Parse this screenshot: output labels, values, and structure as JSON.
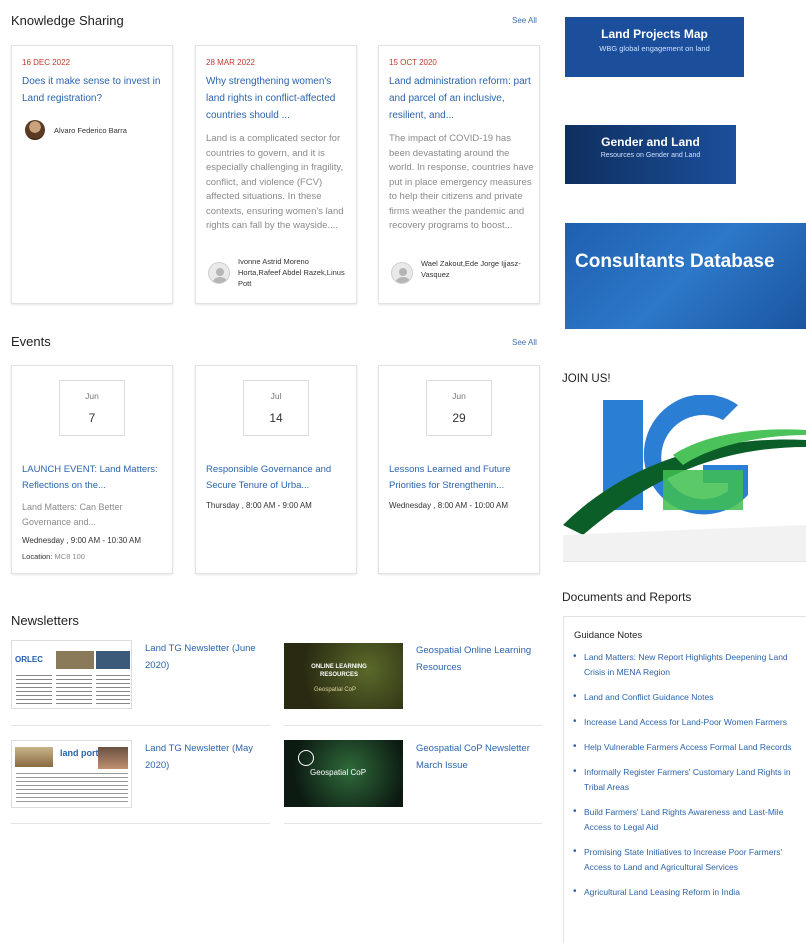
{
  "knowledge": {
    "title": "Knowledge Sharing",
    "see_all": "See All",
    "cards": [
      {
        "date": "16 DEC 2022",
        "title": "Does it make sense to invest in Land registration?",
        "body": "",
        "author": "Alvaro Federico Barra"
      },
      {
        "date": "28 MAR 2022",
        "title": "Why strengthening women's land rights in conflict-affected countries should ...",
        "body": "Land is a complicated sector for countries to govern, and it is especially challenging in fragility, conflict, and violence (FCV) affected situations. In these contexts, ensuring women's land rights can fall by the wayside....",
        "author": "Ivonne Astrid Moreno Horta,Rafeef Abdel Razek,Linus Pott"
      },
      {
        "date": "15 OCT 2020",
        "title": "Land administration reform: part and parcel of an inclusive, resilient, and...",
        "body": "The impact of COVID-19 has been devastating around the world. In response, countries have put in place emergency measures to help their citizens and private firms weather the pandemic and recovery programs to boost...",
        "author": "Wael Zakout,Ede Jorge Ijjasz-Vasquez"
      }
    ]
  },
  "events": {
    "title": "Events",
    "see_all": "See All",
    "cards": [
      {
        "month": "Jun",
        "day": "7",
        "title": "LAUNCH EVENT: Land Matters: Reflections on the...",
        "desc": "Land Matters: Can Better Governance and...",
        "time": "Wednesday , 9:00 AM - 10:30 AM",
        "location_label": "Location:",
        "location": "MC8 100"
      },
      {
        "month": "Jul",
        "day": "14",
        "title": "Responsible Governance and Secure Tenure of Urba...",
        "desc": "",
        "time": "Thursday , 8:00 AM - 9:00 AM"
      },
      {
        "month": "Jun",
        "day": "29",
        "title": "Lessons Learned and Future Priorities for Strengthenin...",
        "desc": "",
        "time": "Wednesday , 8:00 AM - 10:00 AM"
      }
    ]
  },
  "newsletters": {
    "title": "Newsletters",
    "items": [
      {
        "title": "Land TG Newsletter (June 2020)",
        "thumb_text": "ORLEC"
      },
      {
        "title": "Geospatial Online Learning Resources",
        "thumb_text": "ONLINE LEARNING RESOURCES",
        "thumb_sub": "Geospatial CoP"
      },
      {
        "title": "Land TG Newsletter (May 2020)",
        "thumb_text": "land portal"
      },
      {
        "title": "Geospatial CoP Newsletter March Issue",
        "thumb_text": "Geospatial CoP"
      }
    ]
  },
  "sidebar": {
    "banner1": {
      "title": "Land Projects Map",
      "subtitle": "WBG global engagement on land",
      "color": "#1b4f9c"
    },
    "banner2": {
      "title": "Gender and Land",
      "subtitle": "Resources on Gender and Land",
      "color": "#123a72"
    },
    "banner3": {
      "title": "Consultants Database",
      "color": "#1f5fb0"
    },
    "join_title": "JOIN US!",
    "docs_title": "Documents and Reports",
    "guidance_title": "Guidance Notes",
    "docs": [
      "Land Matters: New Report Highlights Deepening Land Crisis in MENA Region",
      "Land and Conflict Guidance Notes",
      "Increase Land Access for Land-Poor Women Farmers",
      "Help Vulnerable Farmers Access Formal Land Records",
      "Informally Register Farmers' Customary Land Rights in Tribal Areas",
      "Build Farmers' Land Rights Awareness and Last-Mile Access to Legal Aid",
      "Promising State Initiatives to Increase Poor Farmers' Access to Land and Agricultural Services",
      "Agricultural Land Leasing Reform in India"
    ]
  }
}
